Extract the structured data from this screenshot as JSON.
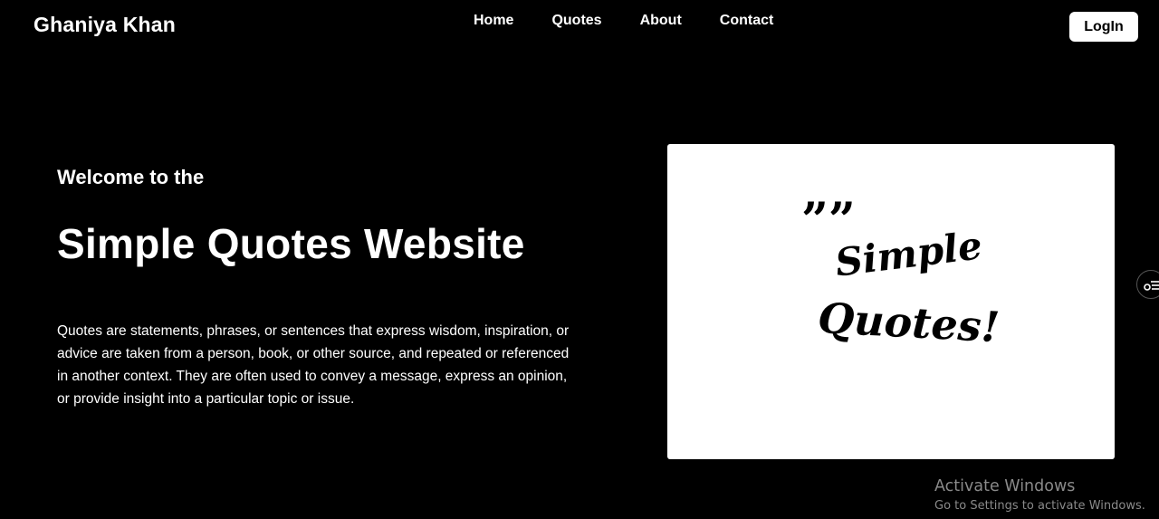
{
  "header": {
    "brand": "Ghaniya Khan",
    "nav": [
      "Home",
      "Quotes",
      "About",
      "Contact"
    ],
    "login_label": "LogIn"
  },
  "hero": {
    "eyebrow": "Welcome to the",
    "title": "Simple Quotes Website",
    "description": "Quotes are statements, phrases, or sentences that express wisdom, inspiration, or advice are taken from a person, book, or other source, and repeated or referenced in another context. They are often used to convey a message, express an opinion, or provide insight into a particular topic or issue.",
    "image": {
      "quote_marks": "””",
      "line1": "Simple",
      "line2": "Quotes!"
    }
  },
  "windows_watermark": {
    "title": "Activate Windows",
    "subtitle": "Go to Settings to activate Windows."
  },
  "icons": {
    "side_widget": "settings-sliders-icon"
  }
}
